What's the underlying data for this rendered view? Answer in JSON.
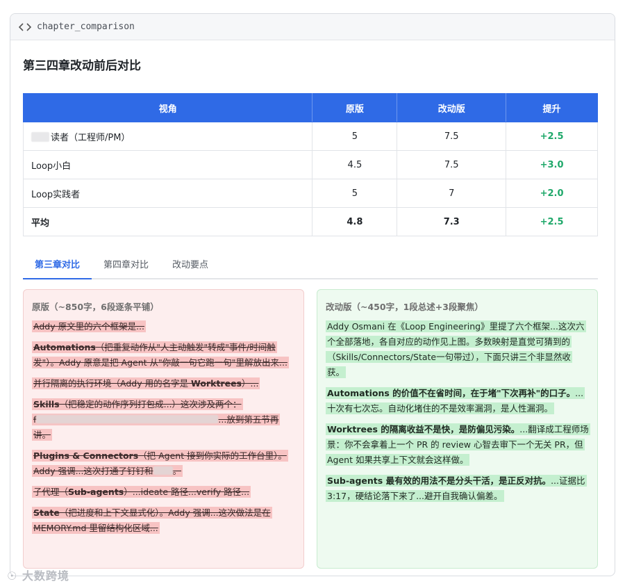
{
  "window": {
    "title": "chapter_comparison"
  },
  "page_title": "第三四章改动前后对比",
  "table": {
    "headers": [
      "视角",
      "原版",
      "改动版",
      "提升"
    ],
    "rows": [
      {
        "name": "读者（工程师/PM）",
        "orig": "5",
        "new": "7.5",
        "delta": "+2.5"
      },
      {
        "name": "Loop小白",
        "orig": "4.5",
        "new": "7.5",
        "delta": "+3.0"
      },
      {
        "name": "Loop实践者",
        "orig": "5",
        "new": "7",
        "delta": "+2.0"
      },
      {
        "name": "平均",
        "orig": "4.8",
        "new": "7.3",
        "delta": "+2.5"
      }
    ],
    "delta_color": "#1fa86a"
  },
  "tabs": [
    "第三章对比",
    "第四章对比",
    "改动要点"
  ],
  "old_panel": {
    "header": "原版（~850字，6段逐条平铺）",
    "p1": "Addy 原文里的六个框架是...",
    "p2_bold": "Automations",
    "p2_rest": "（把重复动作从\"人主动触发\"转成\"事件/时间触发\"）。Addy 原意是把 Agent 从\"你敲一句它跑一句\"里解放出来...",
    "p3_a": "并行隔离的执行环境（Addy 用的名字是 ",
    "p3_bold": "Worktrees",
    "p3_b": "）...",
    "p4_bold": "Skills",
    "p4_a": "（把稳定的动作序列打包成...）这次涉及两个：",
    "p4_b": "f",
    "p4_c": "...放到第五节再讲。",
    "p5_bold": "Plugins & Connectors",
    "p5_rest": "（把 Agent 接到你实际的工作台里）。Addy 强调...这次打通了钉钉和",
    "p5_end": "。",
    "p6_a": "子代理（",
    "p6_bold": "Sub-agents",
    "p6_b": "）...ideate 路径...verify 路径...",
    "p7_bold": "State",
    "p7_rest": "（把进度和上下文显式化）。Addy 强调...这次做法是在 MEMORY.md 里留结构化区域..."
  },
  "new_panel": {
    "header": "改动版（~450字，1段总述+3段聚焦）",
    "p1": "Addy Osmani 在《Loop Engineering》里提了六个框架...这次六个全部落地，各自对应的动作见上图。多数映射是直觉可猜到的（Skills/Connectors/State一句带过），下面只讲三个非显然收获。",
    "p2_bold": "Automations 的价值不在省时间，在于堵\"下次再补\"的口子。",
    "p2_rest": "...十次有七次忘。自动化堵住的不是效率漏洞，是人性漏洞。",
    "p3_bold": "Worktrees 的隔离收益不是快，是防偏见污染。",
    "p3_rest": "...翻译成工程师场景：你不会拿着上一个 PR 的 review 心智去审下一个无关 PR，但 Agent 如果共享上下文就会这样做。",
    "p4_bold": "Sub-agents 最有效的用法不是分头干活，是正反对抗。",
    "p4_rest": "...证据比 3:17，硬结论落下来了...避开自我确认偏差。"
  },
  "watermark": "大数跨境"
}
